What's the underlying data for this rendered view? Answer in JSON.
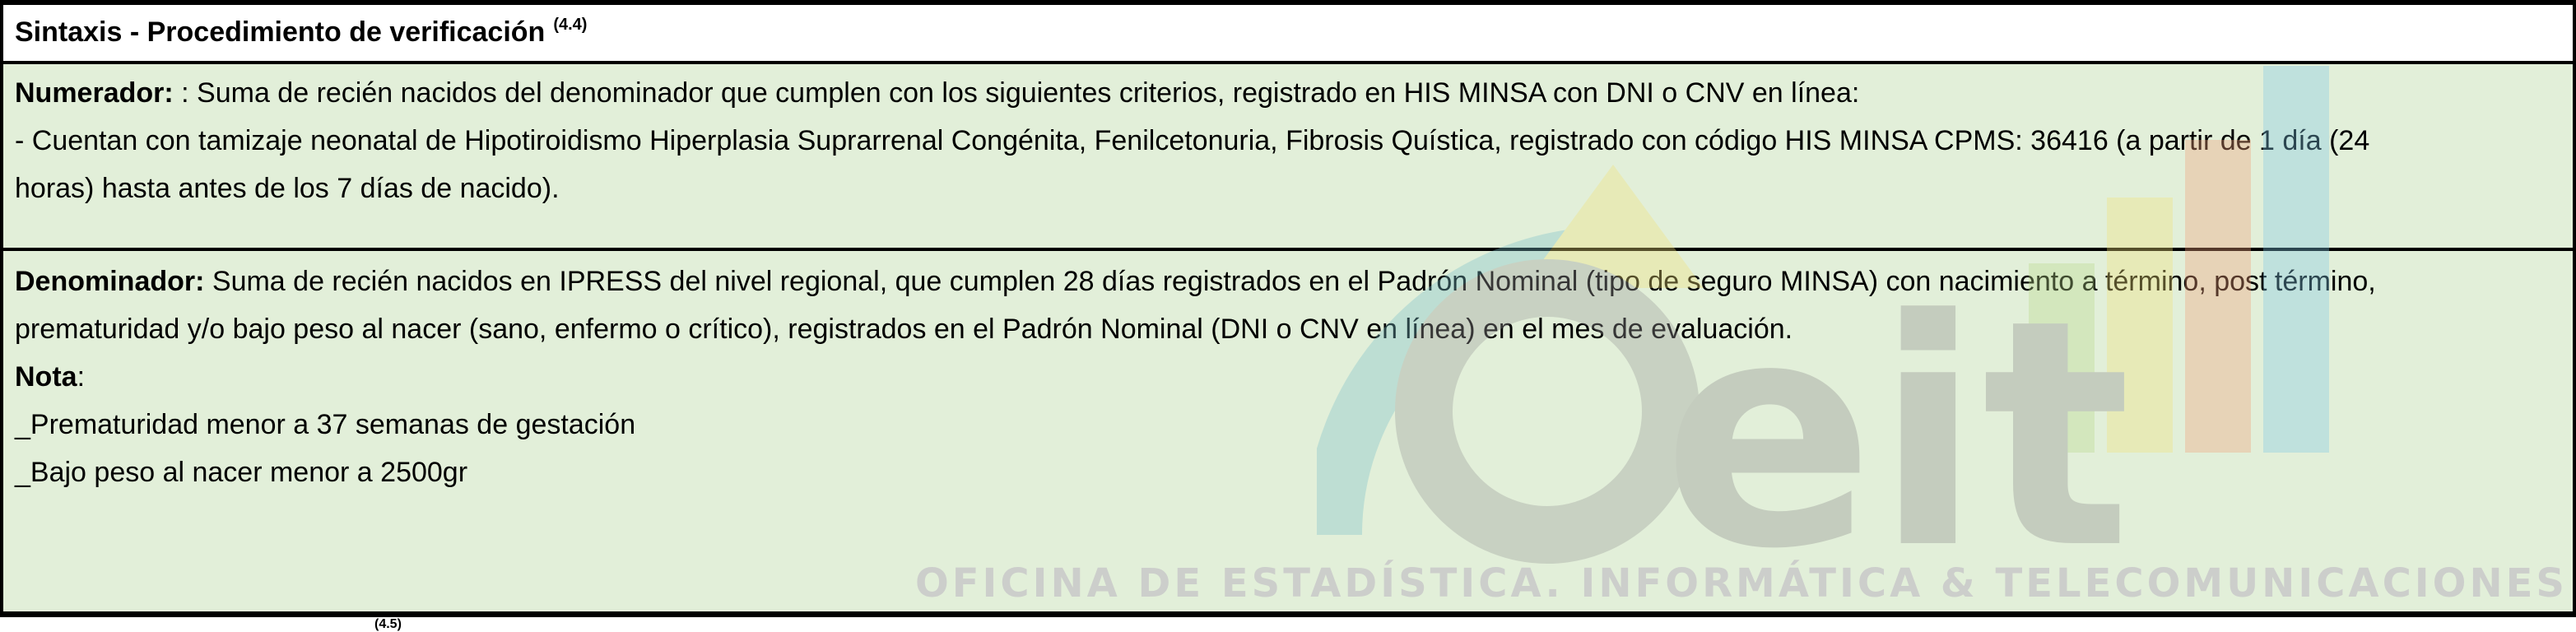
{
  "title": {
    "text": "Sintaxis - Procedimiento de verificación",
    "ref": "(4.4)"
  },
  "numerador": {
    "label": "Numerador:",
    "line1": " : Suma de recién nacidos del  denominador  que cumplen con los siguientes criterios, registrado en HIS MINSA con DNI o CNV en línea:",
    "line2": "- Cuentan con tamizaje neonatal de Hipotiroidismo Hiperplasia Suprarrenal Congénita, Fenilcetonuria, Fibrosis Quística, registrado con código HIS MINSA CPMS: 36416 (a partir de 1 día (24",
    "line3": "horas) hasta antes de los 7 días de nacido)."
  },
  "denominador": {
    "label": "Denominador:",
    "line1": " Suma de recién nacidos en IPRESS del nivel regional, que cumplen 28 días registrados en el Padrón Nominal (tipo de seguro MINSA) con nacimiento a término, post término,",
    "line2": "prematuridad  y/o bajo peso al nacer (sano, enfermo o crítico), registrados en el Padrón Nominal (DNI o CNV en línea) en el mes de evaluación.",
    "nota_label": "Nota",
    "nota_suffix": ":",
    "nota1": "_Prematuridad menor a 37 semanas de gestación",
    "nota2": "_Bajo peso al nacer menor a 2500gr"
  },
  "next_ref": "(4.5)",
  "watermark": {
    "text": "OFICINA DE ESTADÍSTICA. INFORMÁTICA & TELECOMUNICACIONES",
    "logo_letters": "eit",
    "colors": {
      "bar_blue": "#7fc8e6",
      "bar_orange": "#f2a07a",
      "bar_yellow": "#f3e27a",
      "bar_green": "#b8d98a",
      "arc_teal": "#7ac0c8",
      "logo_gray": "#b9b9b9"
    }
  }
}
